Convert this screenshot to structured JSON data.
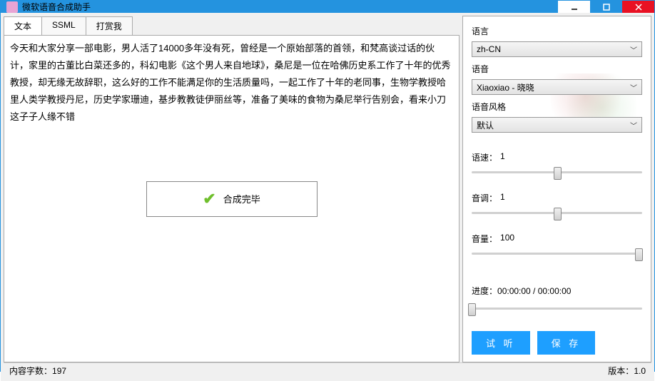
{
  "window": {
    "title": "微软语音合成助手"
  },
  "tabs": [
    {
      "label": "文本",
      "active": true
    },
    {
      "label": "SSML",
      "active": false
    },
    {
      "label": "打赏我",
      "active": false
    }
  ],
  "textarea": {
    "value": "今天和大家分享一部电影，男人活了14000多年没有死，曾经是一个原始部落的首领，和梵高谈过话的伙计，家里的古董比白菜还多的，科幻电影《这个男人来自地球》，桑尼是一位在哈佛历史系工作了十年的优秀教授，却无缘无故辞职，这么好的工作不能满足你的生活质量吗，一起工作了十年的老同事，生物学教授哈里人类学教授丹尼，历史学家珊迪，基步教教徒伊丽丝等，准备了美味的食物为桑尼举行告别会，看来小刀这子子人缘不错"
  },
  "toast": {
    "message": "合成完毕"
  },
  "panel": {
    "language": {
      "label": "语言",
      "value": "zh-CN"
    },
    "voice": {
      "label": "语音",
      "value": "Xiaoxiao - 晓晓"
    },
    "style": {
      "label": "语音风格",
      "value": "默认"
    },
    "rate": {
      "label": "语速：",
      "value": "1",
      "pos": 50
    },
    "pitch": {
      "label": "音调：",
      "value": "1",
      "pos": 50
    },
    "volume": {
      "label": "音量：",
      "value": "100",
      "pos": 98
    },
    "progress": {
      "label": "进度：",
      "value": "00:00:00 / 00:00:00",
      "pos": 0
    },
    "buttons": {
      "listen": "试 听",
      "save": "保 存"
    }
  },
  "status": {
    "charcount_label": "内容字数：",
    "charcount_value": "197",
    "version_label": "版本：",
    "version_value": "1.0"
  }
}
